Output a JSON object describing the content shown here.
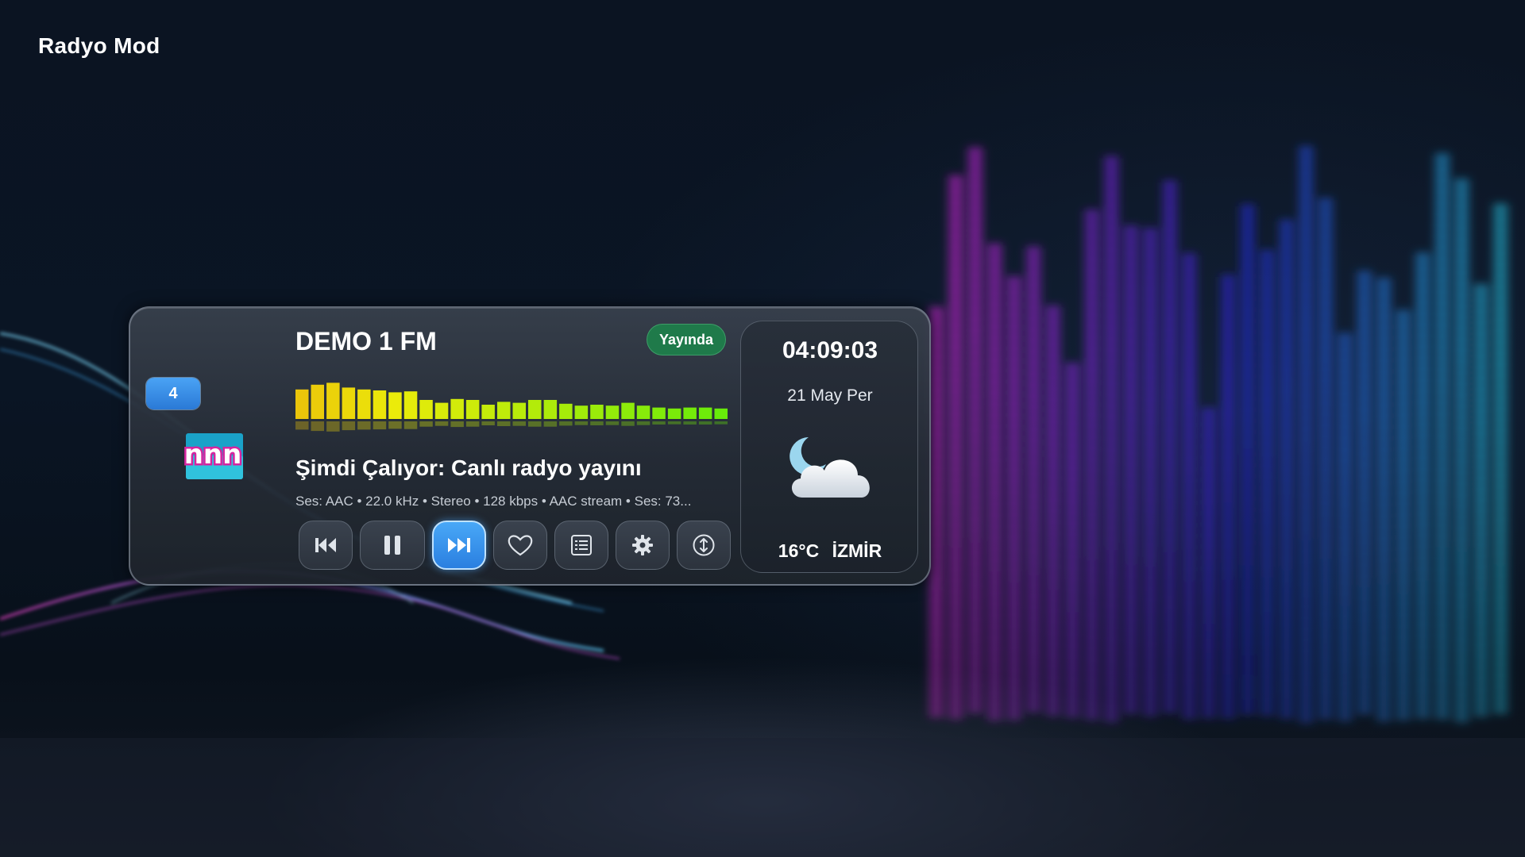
{
  "screen": {
    "title": "Radyo Mod"
  },
  "player": {
    "channel_number": "4",
    "logo_text": "nnn",
    "station_name": "DEMO 1 FM",
    "status_badge": "Yayında",
    "now_playing": "Şimdi Çalıyor: Canlı radyo yayını",
    "info_line": "Ses: AAC  •  22.0 kHz  •  Stereo  •  128 kbps  •  AAC stream  •  Ses: 73...",
    "equalizer_levels": [
      0.62,
      0.72,
      0.76,
      0.66,
      0.62,
      0.6,
      0.56,
      0.58,
      0.4,
      0.34,
      0.42,
      0.4,
      0.3,
      0.36,
      0.34,
      0.4,
      0.4,
      0.32,
      0.28,
      0.3,
      0.28,
      0.34,
      0.28,
      0.24,
      0.22,
      0.24,
      0.24,
      0.22
    ],
    "controls": [
      {
        "name": "previous-button",
        "icon": "skip-previous-icon"
      },
      {
        "name": "pause-button",
        "icon": "pause-icon"
      },
      {
        "name": "next-button",
        "icon": "skip-next-icon",
        "active": true
      },
      {
        "name": "favorite-button",
        "icon": "heart-icon"
      },
      {
        "name": "list-button",
        "icon": "list-icon"
      },
      {
        "name": "settings-button",
        "icon": "gear-icon"
      },
      {
        "name": "swap-button",
        "icon": "swap-vertical-icon"
      }
    ],
    "colors": {
      "accent": "#3d95f0",
      "live": "#1f7a4a"
    }
  },
  "side": {
    "time": "04:09:03",
    "date": "21 May Per",
    "weather_icon": "cloud-moon-icon",
    "temperature": "16°C",
    "city": "İZMİR"
  }
}
